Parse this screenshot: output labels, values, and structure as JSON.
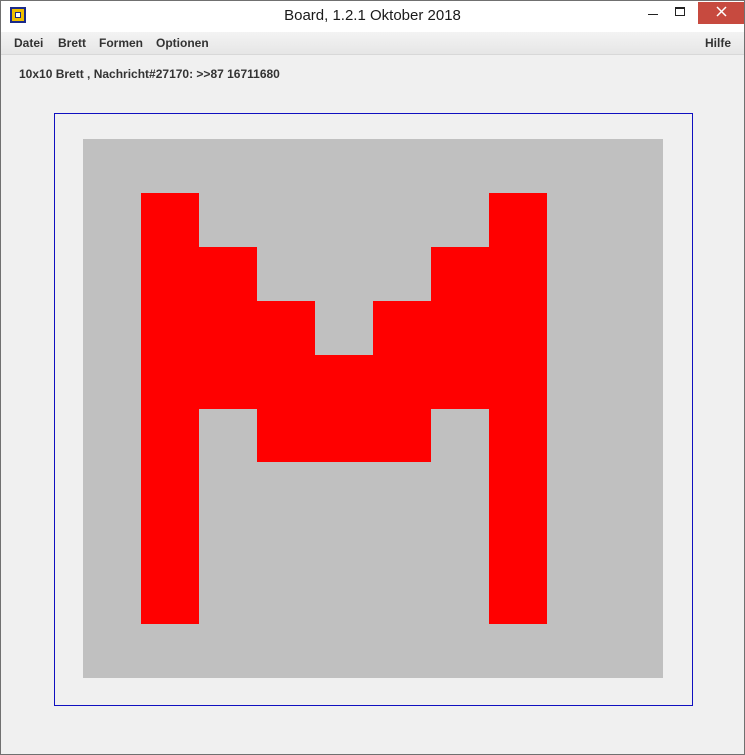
{
  "window": {
    "title": "Board, 1.2.1 Oktober 2018",
    "icons": {
      "app": "board-app-icon",
      "minimize": "minimize-icon",
      "maximize": "maximize-icon",
      "close": "close-icon"
    }
  },
  "menu": {
    "datei": "Datei",
    "brett": "Brett",
    "formen": "Formen",
    "optionen": "Optionen",
    "hilfe": "Hilfe"
  },
  "status": "10x10 Brett , Nachricht#27170: >>87 16711680",
  "board": {
    "rows": 10,
    "cols": 10,
    "background_color": "#c0c0c0",
    "on_color": "#ff0000",
    "grid": [
      "0000000000",
      "0100000100",
      "0110001100",
      "0111011100",
      "0111111100",
      "0101110100",
      "0100000100",
      "0100000100",
      "0100000100",
      "0000000000"
    ]
  }
}
